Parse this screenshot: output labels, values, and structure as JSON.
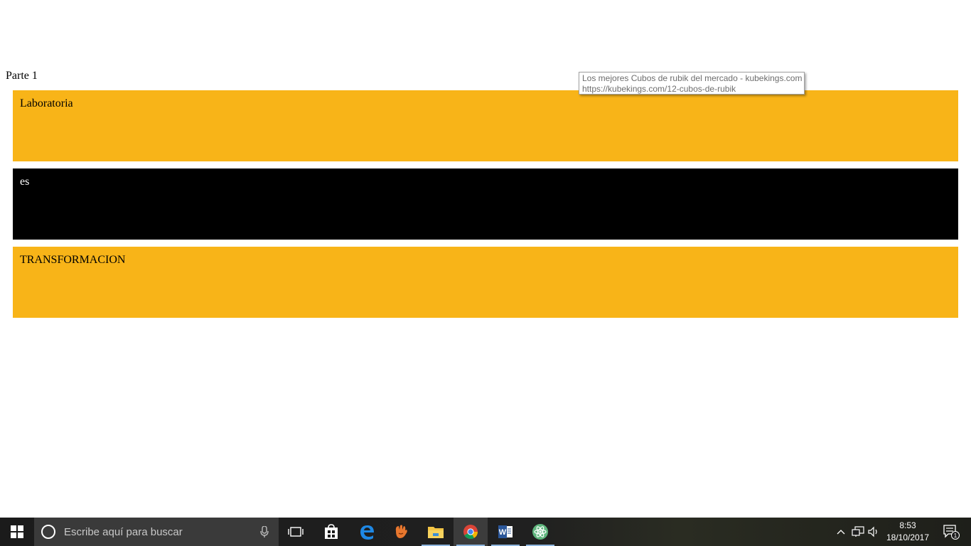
{
  "page": {
    "heading": "Parte 1",
    "blocks": [
      {
        "text": "Laboratoria",
        "color": "#f8b418"
      },
      {
        "text": "es",
        "color": "#000000"
      },
      {
        "text": "TRANSFORMACION",
        "color": "#f8b418"
      }
    ]
  },
  "tooltip": {
    "title": "Los mejores Cubos de rubik del mercado - kubekings.com",
    "url": "https://kubekings.com/12-cubos-de-rubik"
  },
  "taskbar": {
    "search_placeholder": "Escribe aquí para buscar",
    "apps": [
      {
        "name": "task-view-icon"
      },
      {
        "name": "store-icon"
      },
      {
        "name": "edge-icon"
      },
      {
        "name": "mitt-app-icon"
      },
      {
        "name": "file-explorer-icon"
      },
      {
        "name": "chrome-icon"
      },
      {
        "name": "word-icon"
      },
      {
        "name": "atom-icon"
      }
    ],
    "clock": {
      "time": "8:53",
      "date": "18/10/2017"
    },
    "notifications_count": "1"
  }
}
